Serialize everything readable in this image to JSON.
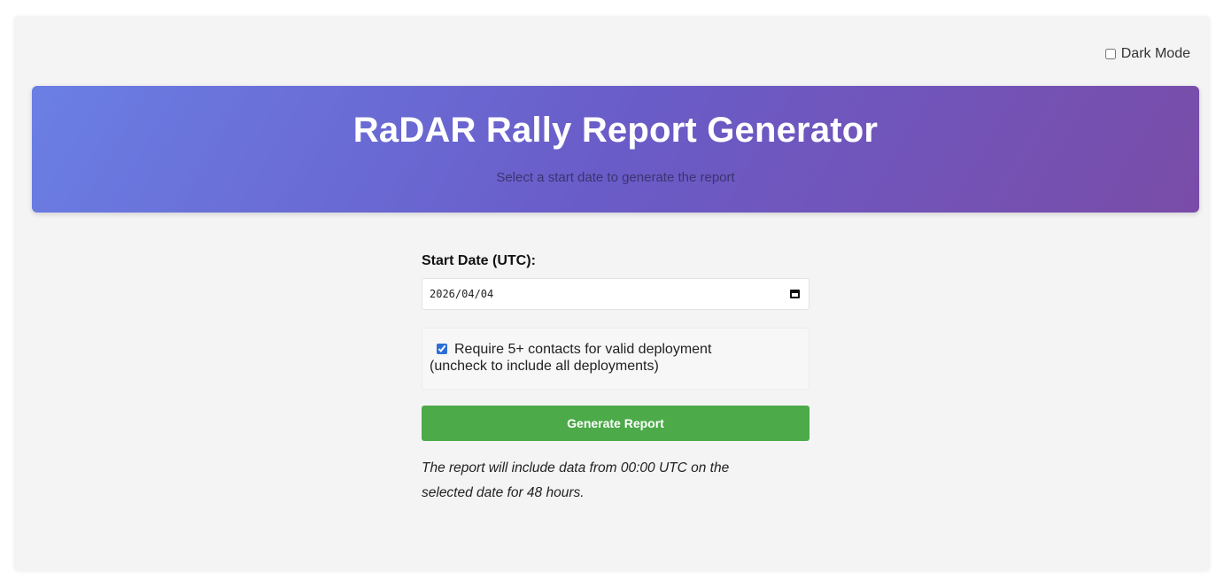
{
  "dark_mode": {
    "label": "Dark Mode",
    "checked": false
  },
  "header": {
    "title": "RaDAR Rally Report Generator",
    "subtitle": "Select a start date to generate the report",
    "gradient_start": "#6a7fe4",
    "gradient_end": "#7a4ca8"
  },
  "form": {
    "start_date_label": "Start Date (UTC):",
    "start_date_value": "2026/04/04",
    "calendar_icon": "calendar-icon",
    "require_contacts": {
      "checked": true,
      "line1": "Require 5+ contacts for valid deployment",
      "line2": "(uncheck to include all deployments)"
    },
    "generate_button_label": "Generate Report",
    "generate_button_color": "#4caa49",
    "note_line1": "The report will include data from 00:00 UTC on the",
    "note_line2": "selected date for 48 hours."
  }
}
